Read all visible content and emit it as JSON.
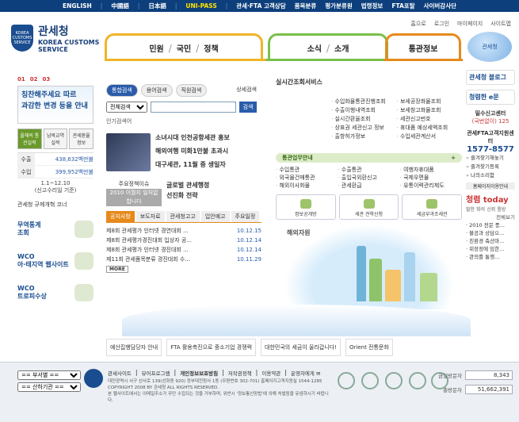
{
  "topbar": {
    "items": [
      "ENGLISH",
      "中國語",
      "日本語",
      "UNI-PASS",
      "관세·FTA 고객상담",
      "품목분류",
      "평가분류원",
      "법령정보",
      "FTA포탈",
      "사이버감사단"
    ]
  },
  "util": [
    "홈으로",
    "로그인",
    "마이페이지",
    "사이트맵"
  ],
  "logo": {
    "ko": "관세청",
    "en1": "KOREA CUSTOMS",
    "en2": "SERVICE",
    "emblem": "KOREA CUSTOMS SERVICE"
  },
  "gnav": {
    "g1": [
      "민원",
      "국민",
      "정책"
    ],
    "g2": [
      "소식",
      "소개"
    ],
    "g3": [
      "통관정보"
    ]
  },
  "mascot": "관세청",
  "left": {
    "pager": [
      "01",
      "02",
      "03"
    ],
    "banner_line1": "칭찬해주세요 따르",
    "banner_line2": "과감한 변경 등을 안내",
    "tabs": [
      "올해의 통관실적",
      "남북교역 실적",
      "관세환율 정보"
    ],
    "stats": [
      {
        "label": "수출",
        "value": "438,632백만불"
      },
      {
        "label": "수입",
        "value": "399,952백만불"
      }
    ],
    "period1": "1.1~12.10",
    "period2": "(신고수리일 기준)",
    "korline": "관세청 규제개혁 코너",
    "btns": [
      {
        "l1": "무역통계",
        "l2": "조회"
      },
      {
        "l1": "WCO",
        "l2": "아·태지역 웹사이트"
      },
      {
        "l1": "WCO",
        "l2": "트로피수상"
      }
    ]
  },
  "search": {
    "tabs": [
      "통합검색",
      "용어검색",
      "직원검색"
    ],
    "detail": "상세검색",
    "select": "전체검색",
    "button": "검색",
    "popular": "인기검색어"
  },
  "news": [
    "소녀시대 인천공항세관 홍보",
    "해외여행 미화1만불 초과시",
    "대구세관, 11월 중 생일자"
  ],
  "program": {
    "l1": "주요정책이슈",
    "date": "2010 이월지 일처없합니다",
    "r1": "글로벌 관세행정",
    "r2": "선진화 전략"
  },
  "notice": {
    "tabs": [
      "공지사항",
      "보도자료",
      "관세청고고",
      "입안예고",
      "주요일정"
    ],
    "items": [
      {
        "title": "제8회 관세평가 인터넷 경연대회 ...",
        "date": "10.12.15"
      },
      {
        "title": "제8회 관세평가경진대회 입상자 공...",
        "date": "10.12.14"
      },
      {
        "title": "제8회 관세평가 인터넷 경진대회 ...",
        "date": "10.12.14"
      },
      {
        "title": "제11회 관세품목분류 경진대회 수...",
        "date": "10.11.29"
      }
    ],
    "more": "MORE"
  },
  "realtime": {
    "title": "실시간조회서비스",
    "items": [
      "수입화물통관진행조회",
      "보세공장화물조회",
      "수출이행내역조회",
      "보세창고화물조회",
      "실시간환율조회",
      "세관신고번호",
      "상표권 세관신고 정보",
      "휴대품 예상세액조회",
      "출항허가정보",
      "수입세관계산서"
    ]
  },
  "biz": {
    "title": "통관업무안내",
    "items": [
      "수입통관",
      "수출통관",
      "여행자휴대품",
      "외국물건매통관",
      "출입국외환신고",
      "국제우편물",
      "해외이사화물",
      "관세환급",
      "유통이력관리제도"
    ]
  },
  "quick": [
    "정보공개방",
    "세관 견학신청",
    "세금부과조세관"
  ],
  "illus": {
    "kw": "해외자원"
  },
  "right": {
    "box1": "관세청 블로그",
    "box2": "청렴한 e문",
    "center": "밀수신고센터",
    "center_num": "(국번없이) 125",
    "fta": "관세FTA고객지원센터",
    "fta_num": "1577-8577",
    "fav": [
      "즐겨찾기해놓기",
      "즐겨찾기등록",
      "나의소리함"
    ],
    "sub": "홈페이지이용안내",
    "today": "청렴 today",
    "today_sub": "발한 화의 신뢰 통방",
    "today_label": "전체보기",
    "today_items": [
      "· 2010 전문 풍...",
      "· 불공과 상담으...",
      "· 친환경 축산마...",
      "· 위장정에 임한...",
      "· 관의를 통행..."
    ]
  },
  "banners": [
    "예산집행담당자 안내",
    "FTA 활용촉진으로 중소기업 경쟁력",
    "대한민국의 세금이 울라갑니다!",
    "Orient 전통문화"
  ],
  "footer": {
    "sel1": "== 부서별 ==",
    "sel2": "== 산하기관 ==",
    "links": [
      "관세사이트",
      "뷰어프로그램",
      "개인정보보호방침",
      "저작권정책",
      "이용약관",
      "운영자에게 ✉"
    ],
    "addr1": "대전광역시 서구 선사로 139(선화동 920) 정부대전청사 1동 (우편번호 302-701) 홈페이지고객지원실 1544-1285",
    "addr2": "COPYRIGHT 2008 BY 관세청 ALL RIGHTS RESERVED.",
    "addr3": "본 웹사이트에서는 이메일주소가 무단 수집되는 것을 거부하며, 위반시 '정보통신망법'에 의해 처벌됨을 유념하시기 바랍니다.",
    "today_label": "금일방문자",
    "today_val": "8,343",
    "total_label": "총방문자",
    "total_val": "51,662,391"
  },
  "colors": {
    "topbar": "#0d3f7c",
    "nav_yellow": "#f0b428",
    "nav_green": "#7ac04a",
    "nav_orange": "#e58a1c"
  }
}
